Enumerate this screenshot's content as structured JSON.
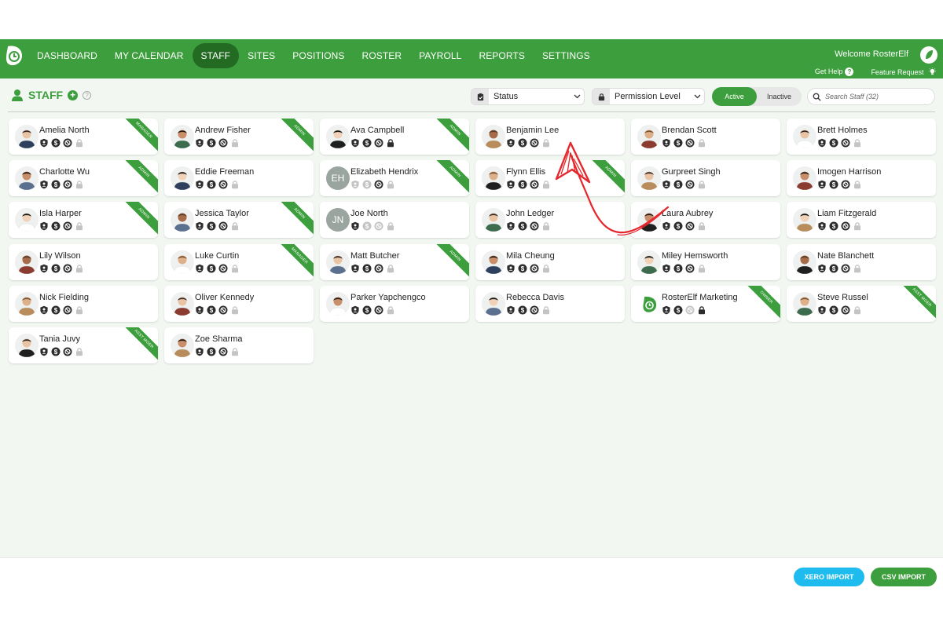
{
  "header": {
    "nav": [
      "DASHBOARD",
      "MY CALENDAR",
      "STAFF",
      "SITES",
      "POSITIONS",
      "ROSTER",
      "PAYROLL",
      "REPORTS",
      "SETTINGS"
    ],
    "active_index": 2,
    "welcome": "Welcome RosterElf",
    "get_help": "Get Help",
    "feature_request": "Feature Request"
  },
  "page": {
    "title": "STAFF",
    "status_filter": "Status",
    "permission_filter": "Permission Level",
    "toggle_active": "Active",
    "toggle_inactive": "Inactive",
    "search_placeholder": "Search Staff (32)"
  },
  "colors": {
    "brand": "#3c9e3c",
    "brand_dark": "#236b23",
    "xero": "#1ebcee",
    "annotation": "#e5272d"
  },
  "staff": [
    {
      "name": "Amelia North",
      "badge": "MANAGER",
      "avatar": "photo",
      "icons": [
        1,
        1,
        1,
        0
      ]
    },
    {
      "name": "Andrew Fisher",
      "badge": "ADMIN",
      "avatar": "photo",
      "icons": [
        1,
        1,
        1,
        0
      ]
    },
    {
      "name": "Ava Campbell",
      "badge": "ADMIN",
      "avatar": "photo",
      "icons": [
        1,
        1,
        1,
        1
      ]
    },
    {
      "name": "Benjamin Lee",
      "badge": "",
      "avatar": "photo",
      "icons": [
        1,
        1,
        1,
        0
      ]
    },
    {
      "name": "Brendan Scott",
      "badge": "",
      "avatar": "photo",
      "icons": [
        1,
        1,
        1,
        0
      ]
    },
    {
      "name": "Brett Holmes",
      "badge": "",
      "avatar": "photo",
      "icons": [
        1,
        1,
        1,
        0
      ]
    },
    {
      "name": "Charlotte Wu",
      "badge": "ADMIN",
      "avatar": "photo",
      "icons": [
        1,
        1,
        1,
        0
      ]
    },
    {
      "name": "Eddie Freeman",
      "badge": "",
      "avatar": "photo",
      "icons": [
        1,
        1,
        1,
        0
      ]
    },
    {
      "name": "Elizabeth Hendrix",
      "badge": "ADMIN",
      "avatar": "EH",
      "icons": [
        0,
        0,
        1,
        0
      ]
    },
    {
      "name": "Flynn Ellis",
      "badge": "ADMIN",
      "avatar": "photo",
      "icons": [
        1,
        1,
        1,
        0
      ]
    },
    {
      "name": "Gurpreet Singh",
      "badge": "",
      "avatar": "photo",
      "icons": [
        1,
        1,
        1,
        0
      ]
    },
    {
      "name": "Imogen Harrison",
      "badge": "",
      "avatar": "photo",
      "icons": [
        1,
        1,
        1,
        0
      ]
    },
    {
      "name": "Isla Harper",
      "badge": "ADMIN",
      "avatar": "photo",
      "icons": [
        1,
        1,
        1,
        0
      ]
    },
    {
      "name": "Jessica Taylor",
      "badge": "ADMIN",
      "avatar": "photo",
      "icons": [
        1,
        1,
        1,
        0
      ]
    },
    {
      "name": "Joe North",
      "badge": "",
      "avatar": "JN",
      "icons": [
        1,
        0,
        0,
        0
      ]
    },
    {
      "name": "John Ledger",
      "badge": "",
      "avatar": "photo",
      "icons": [
        1,
        1,
        1,
        0
      ]
    },
    {
      "name": "Laura Aubrey",
      "badge": "",
      "avatar": "photo",
      "icons": [
        1,
        1,
        1,
        0
      ]
    },
    {
      "name": "Liam Fitzgerald",
      "badge": "",
      "avatar": "photo",
      "icons": [
        1,
        1,
        1,
        0
      ]
    },
    {
      "name": "Lily Wilson",
      "badge": "",
      "avatar": "photo",
      "icons": [
        1,
        1,
        1,
        0
      ]
    },
    {
      "name": "Luke Curtin",
      "badge": "MANAGER",
      "avatar": "photo",
      "icons": [
        1,
        1,
        1,
        0
      ]
    },
    {
      "name": "Matt Butcher",
      "badge": "ADMIN",
      "avatar": "photo",
      "icons": [
        1,
        1,
        1,
        0
      ]
    },
    {
      "name": "Mila Cheung",
      "badge": "",
      "avatar": "photo",
      "icons": [
        1,
        1,
        1,
        0
      ]
    },
    {
      "name": "Miley Hemsworth",
      "badge": "",
      "avatar": "photo",
      "icons": [
        1,
        1,
        1,
        0
      ]
    },
    {
      "name": "Nate Blanchett",
      "badge": "",
      "avatar": "photo",
      "icons": [
        1,
        1,
        1,
        0
      ]
    },
    {
      "name": "Nick Fielding",
      "badge": "",
      "avatar": "photo",
      "icons": [
        1,
        1,
        1,
        0
      ]
    },
    {
      "name": "Oliver Kennedy",
      "badge": "",
      "avatar": "photo",
      "icons": [
        1,
        1,
        1,
        0
      ]
    },
    {
      "name": "Parker Yapchengco",
      "badge": "",
      "avatar": "photo",
      "icons": [
        1,
        1,
        1,
        0
      ]
    },
    {
      "name": "Rebecca Davis",
      "badge": "",
      "avatar": "photo",
      "icons": [
        1,
        1,
        1,
        0
      ]
    },
    {
      "name": "RosterElf Marketing",
      "badge": "OWNER",
      "avatar": "logo",
      "icons": [
        1,
        1,
        0,
        1
      ]
    },
    {
      "name": "Steve Russel",
      "badge": "ASST MGER",
      "avatar": "photo",
      "icons": [
        1,
        1,
        1,
        0
      ]
    },
    {
      "name": "Tania Juvy",
      "badge": "ASST MGER",
      "avatar": "photo",
      "icons": [
        1,
        1,
        1,
        0
      ]
    },
    {
      "name": "Zoe Sharma",
      "badge": "",
      "avatar": "photo",
      "icons": [
        1,
        1,
        1,
        0
      ]
    }
  ],
  "footer": {
    "xero_import": "XERO IMPORT",
    "csv_import": "CSV IMPORT"
  }
}
